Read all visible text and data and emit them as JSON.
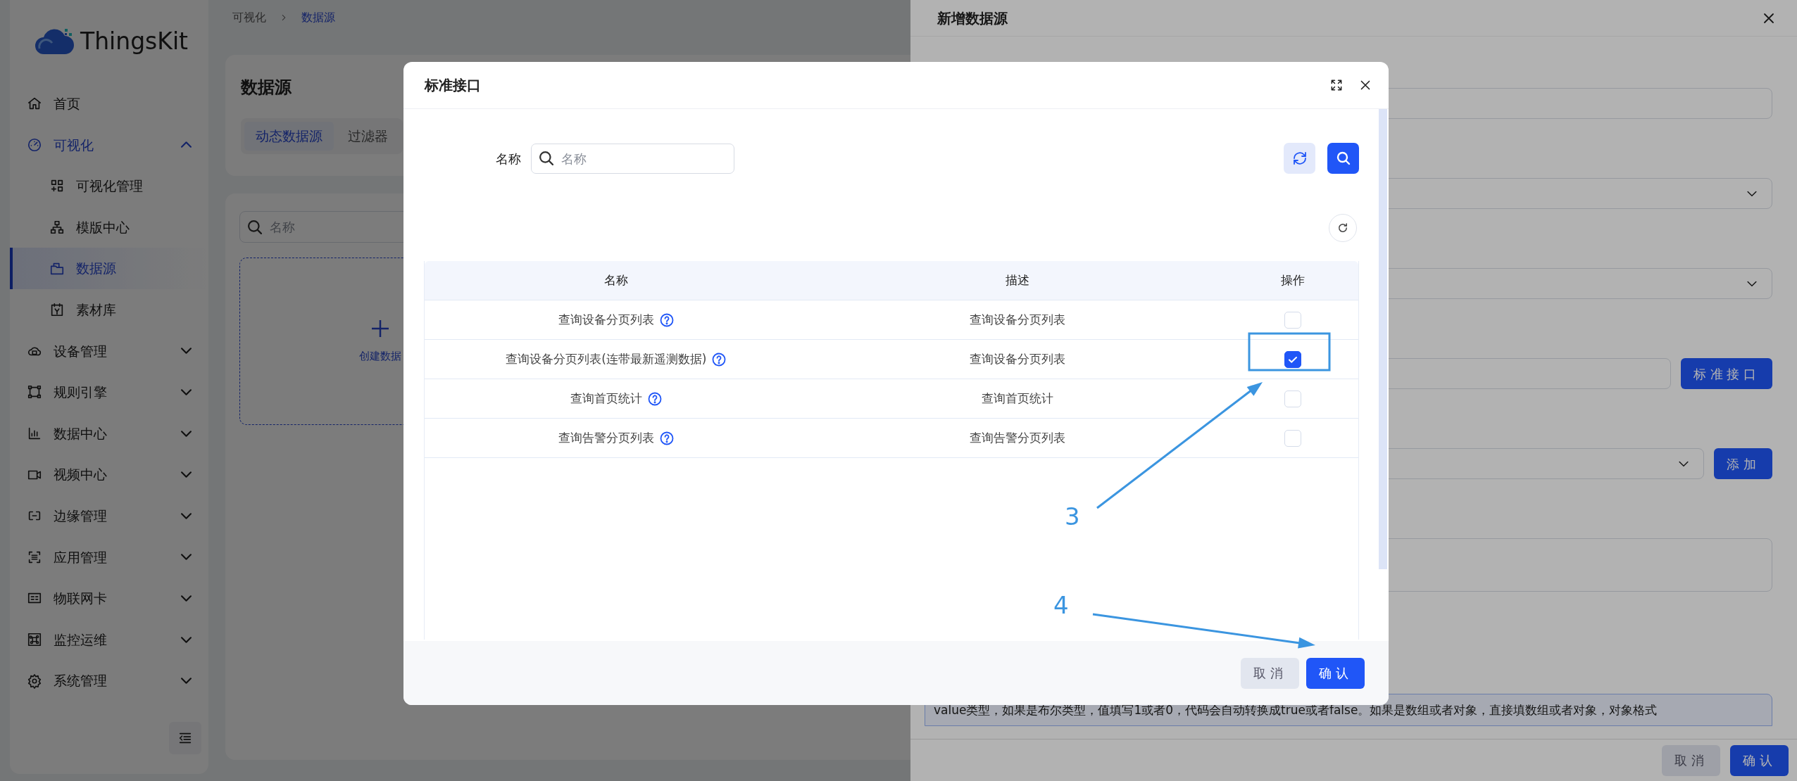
{
  "sidebar": {
    "logo": "ThingsKit",
    "items": [
      {
        "label": "首页",
        "selected": false
      },
      {
        "label": "可视化",
        "selected": true,
        "expanded": true,
        "children": [
          {
            "label": "可视化管理",
            "selected": false
          },
          {
            "label": "模版中心",
            "selected": false
          },
          {
            "label": "数据源",
            "selected": true
          },
          {
            "label": "素材库",
            "selected": false
          }
        ]
      },
      {
        "label": "设备管理",
        "selected": false,
        "expanded": false
      },
      {
        "label": "规则引擎",
        "selected": false,
        "expanded": false
      },
      {
        "label": "数据中心",
        "selected": false,
        "expanded": false
      },
      {
        "label": "视频中心",
        "selected": false,
        "expanded": false
      },
      {
        "label": "边缘管理",
        "selected": false,
        "expanded": false
      },
      {
        "label": "应用管理",
        "selected": false,
        "expanded": false
      },
      {
        "label": "物联网卡",
        "selected": false,
        "expanded": false
      },
      {
        "label": "监控运维",
        "selected": false,
        "expanded": false
      },
      {
        "label": "系统管理",
        "selected": false,
        "expanded": false
      }
    ]
  },
  "breadcrumb": [
    "可视化",
    "数据源"
  ],
  "page": {
    "title": "数据源",
    "tabs": [
      {
        "label": "动态数据源",
        "selected": true
      },
      {
        "label": "过滤器",
        "selected": false
      }
    ],
    "search": {
      "placeholder": "名称"
    },
    "create_card": {
      "label": "创建数据"
    }
  },
  "drawer": {
    "title": "新增数据源",
    "fields": [
      {
        "kind": "input"
      },
      {
        "kind": "select"
      },
      {
        "kind": "select"
      },
      {
        "kind": "input_button",
        "button": "标准接口"
      },
      {
        "kind": "select_button",
        "button": "添加"
      },
      {
        "kind": "textarea"
      }
    ],
    "note": "value类型，如果是布尔类型，值填写1或者0，代码会自动转换成true或者false。如果是数组或者对象，直接填数组或者对象，对象格式",
    "buttons": [
      "取消",
      "确认"
    ]
  },
  "modal": {
    "title": "标准接口",
    "search": {
      "label": "名称",
      "placeholder": "名称"
    },
    "table": {
      "columns": [
        "名称",
        "描述",
        "操作"
      ],
      "rows": [
        {
          "name": "查询设备分页列表",
          "description": "查询设备分页列表",
          "checked": false
        },
        {
          "name": "查询设备分页列表(连带最新遥测数据)",
          "description": "查询设备分页列表",
          "checked": true
        },
        {
          "name": "查询首页统计",
          "description": "查询首页统计",
          "checked": false
        },
        {
          "name": "查询告警分页列表",
          "description": "查询告警分页列表",
          "checked": false
        }
      ]
    },
    "buttons": [
      "取消",
      "确认"
    ]
  },
  "annotations": [
    {
      "label": "3"
    },
    {
      "label": "4"
    }
  ]
}
